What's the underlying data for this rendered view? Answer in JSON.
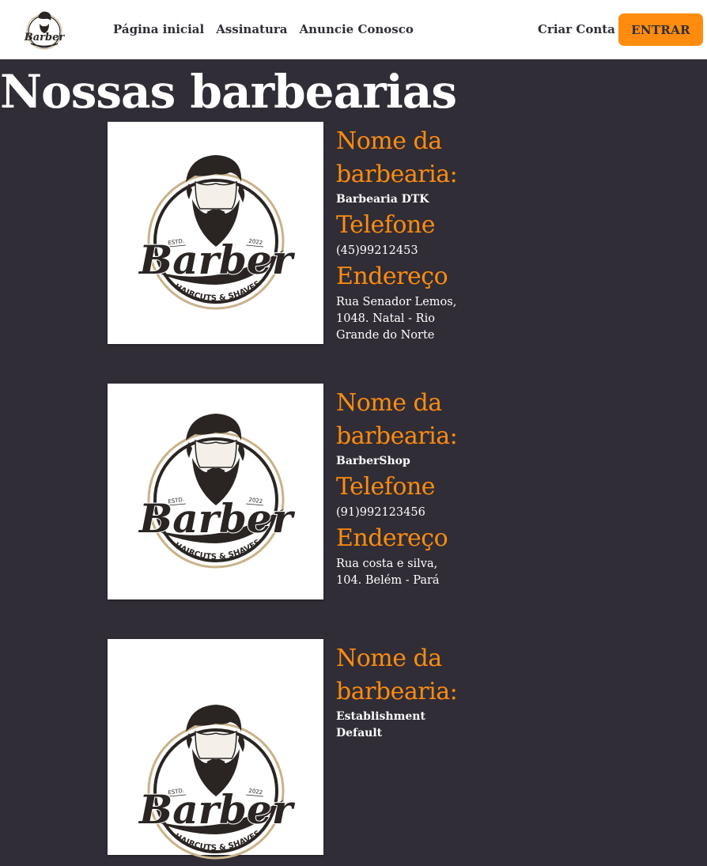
{
  "nav": {
    "logo_alt": "Barber",
    "links": [
      "Página inicial",
      "Assinatura",
      "Anuncie Conosco"
    ],
    "criar_conta": "Criar Conta",
    "entrar": "ENTRAR"
  },
  "page_title": "Nossas barbearias",
  "labels": {
    "nome": "Nome da barbearia:",
    "telefone": "Telefone",
    "endereco": "Endereço"
  },
  "logo_text": {
    "estd": "ESTD.",
    "year": "2022",
    "brand": "Barber",
    "tagline": "HAIRCUTS & SHAVES"
  },
  "barbearias": [
    {
      "nome": "Barbearia DTK",
      "telefone": "(45)99212453",
      "endereco": "Rua Senador Lemos, 1048. Natal - Rio Grande do Norte"
    },
    {
      "nome": "BarberShop",
      "telefone": "(91)992123456",
      "endereco": "Rua costa e silva, 104. Belém - Pará"
    },
    {
      "nome": "Establishment Default",
      "telefone": "",
      "endereco": ""
    }
  ],
  "colors": {
    "background": "#302d36",
    "accent": "#ff8c0f",
    "navbar": "#ffffff"
  }
}
